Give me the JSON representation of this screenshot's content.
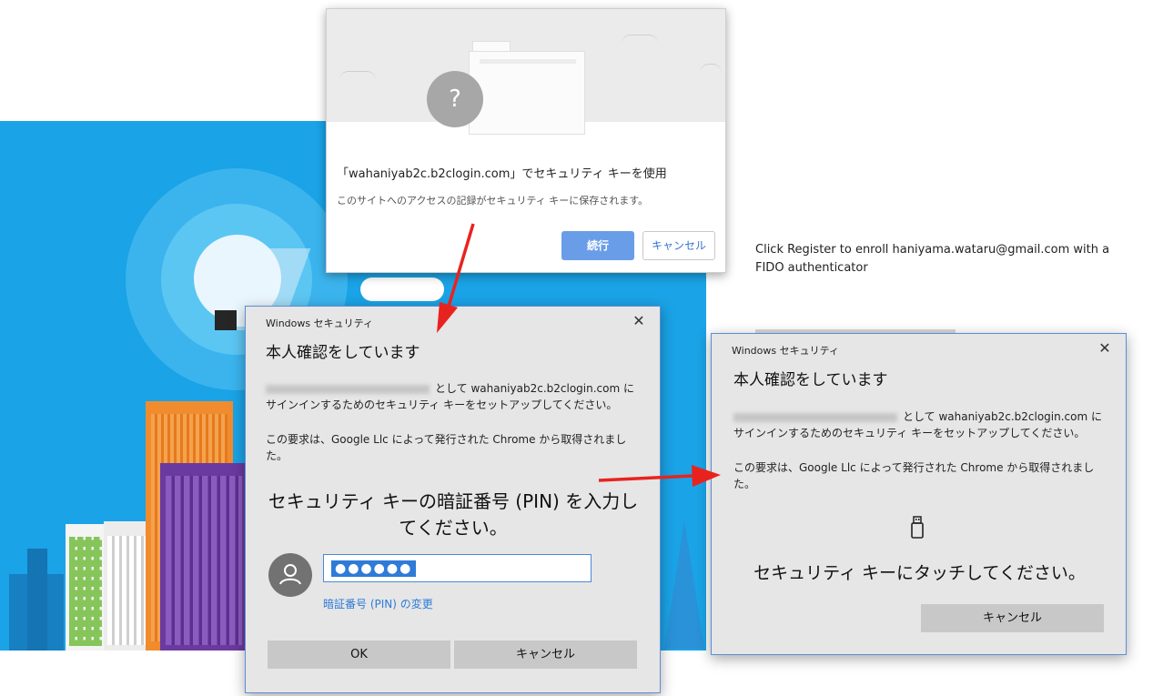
{
  "chrome_dialog": {
    "title": "「wahaniyab2c.b2clogin.com」でセキュリティ キーを使用",
    "subtitle": "このサイトへのアクセスの記録がセキュリティ キーに保存されます。",
    "illustration_symbol": "?",
    "continue_label": "続行",
    "cancel_label": "キャンセル"
  },
  "register_text": "Click Register to enroll haniyama.wataru@gmail.com with a FIDO authenticator",
  "pin_dialog": {
    "caption": "Windows セキュリティ",
    "close_symbol": "✕",
    "heading": "本人確認をしています",
    "line1_suffix": "として wahaniyab2c.b2clogin.com に",
    "line2": "サインインするためのセキュリティ キーをセットアップしてください。",
    "request_text": "この要求は、Google Llc によって発行された Chrome から取得されました。",
    "pin_prompt": "セキュリティ キーの暗証番号 (PIN) を入力してください。",
    "pin_value": "●●●●●●",
    "change_pin_link": "暗証番号 (PIN) の変更",
    "ok_label": "OK",
    "cancel_label": "キャンセル"
  },
  "touch_dialog": {
    "caption": "Windows セキュリティ",
    "close_symbol": "✕",
    "heading": "本人確認をしています",
    "line1_suffix": "として wahaniyab2c.b2clogin.com に",
    "line2": "サインインするためのセキュリティ キーをセットアップしてください。",
    "request_text": "この要求は、Google Llc によって発行された Chrome から取得されました。",
    "touch_prompt": "セキュリティ キーにタッチしてください。",
    "cancel_label": "キャンセル"
  },
  "colors": {
    "hero_blue": "#1aa3e6",
    "chrome_primary": "#6a9de8",
    "link_blue": "#2e7bd8",
    "arrow_red": "#e8231f",
    "dialog_gray": "#e6e6e6"
  },
  "icons": [
    "question-icon",
    "lightbulb-icon",
    "close-icon",
    "user-avatar-icon",
    "usb-key-icon"
  ]
}
